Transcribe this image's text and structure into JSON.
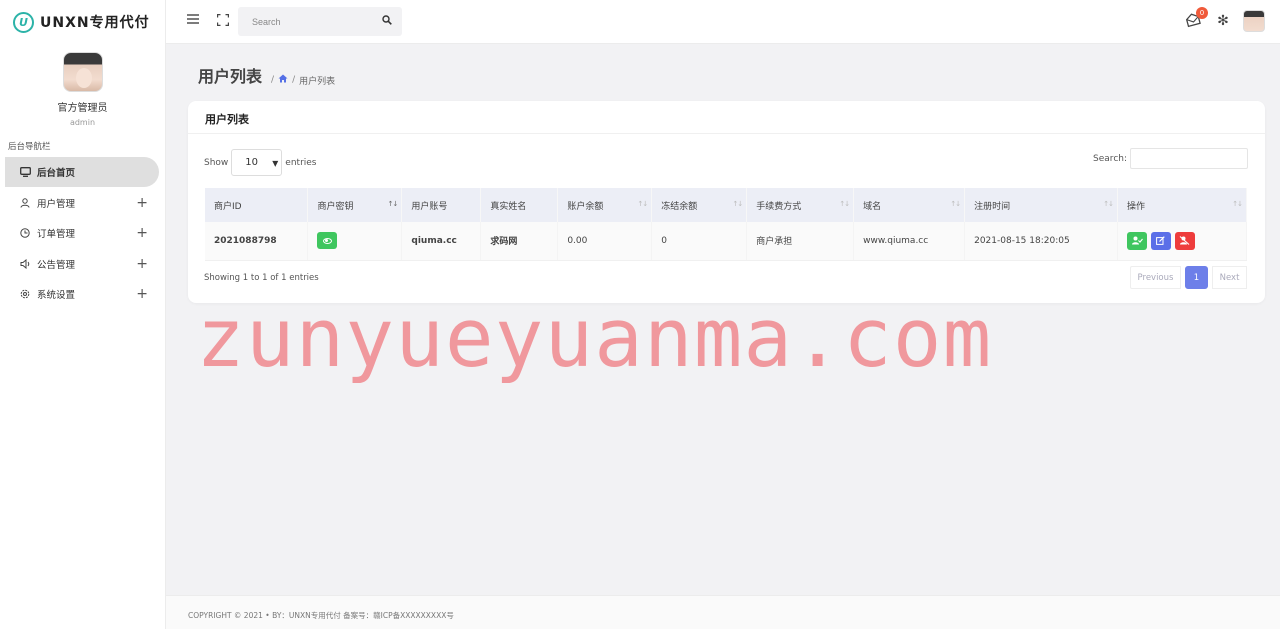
{
  "brand": {
    "logo_letter": "U",
    "name": "UNXN专用代付"
  },
  "profile": {
    "name": "官方管理员",
    "role": "admin"
  },
  "sidebar": {
    "section_title": "后台导航栏",
    "items": [
      {
        "label": "后台首页",
        "icon": "monitor-icon"
      },
      {
        "label": "用户管理",
        "icon": "user-icon"
      },
      {
        "label": "订单管理",
        "icon": "clock-icon"
      },
      {
        "label": "公告管理",
        "icon": "speaker-icon"
      },
      {
        "label": "系统设置",
        "icon": "gear-icon"
      }
    ]
  },
  "topbar": {
    "search_placeholder": "Search",
    "notification_count": "0"
  },
  "page": {
    "title": "用户列表",
    "breadcrumb_sep": "/",
    "breadcrumb_current": "用户列表"
  },
  "card": {
    "title": "用户列表",
    "show_label": "Show",
    "page_length": "10",
    "entries_label": "entries",
    "search_label": "Search:"
  },
  "table": {
    "columns": [
      "商户ID",
      "商户密钥",
      "用户账号",
      "真实姓名",
      "账户余额",
      "冻结余额",
      "手续费方式",
      "域名",
      "注册时间",
      "操作"
    ],
    "rows": [
      {
        "merchant_id": "2021088798",
        "account": "qiuma.cc",
        "real_name": "求码网",
        "balance": "0.00",
        "frozen": "0",
        "fee_mode": "商户承担",
        "domain": "www.qiuma.cc",
        "registered": "2021-08-15 18:20:05"
      }
    ]
  },
  "pagination": {
    "info": "Showing 1 to 1 of 1 entries",
    "prev": "Previous",
    "current": "1",
    "next": "Next"
  },
  "watermark": "zunyueyuanma.com",
  "footer": "COPYRIGHT © 2021 • BY：UNXN专用代付    备案号：赣ICP备XXXXXXXXX号",
  "colors": {
    "accent": "#6d7fe9",
    "green": "#3fc65f",
    "red": "#ee3c3c",
    "link": "#2f3bd9",
    "watermark": "#f07f85"
  }
}
